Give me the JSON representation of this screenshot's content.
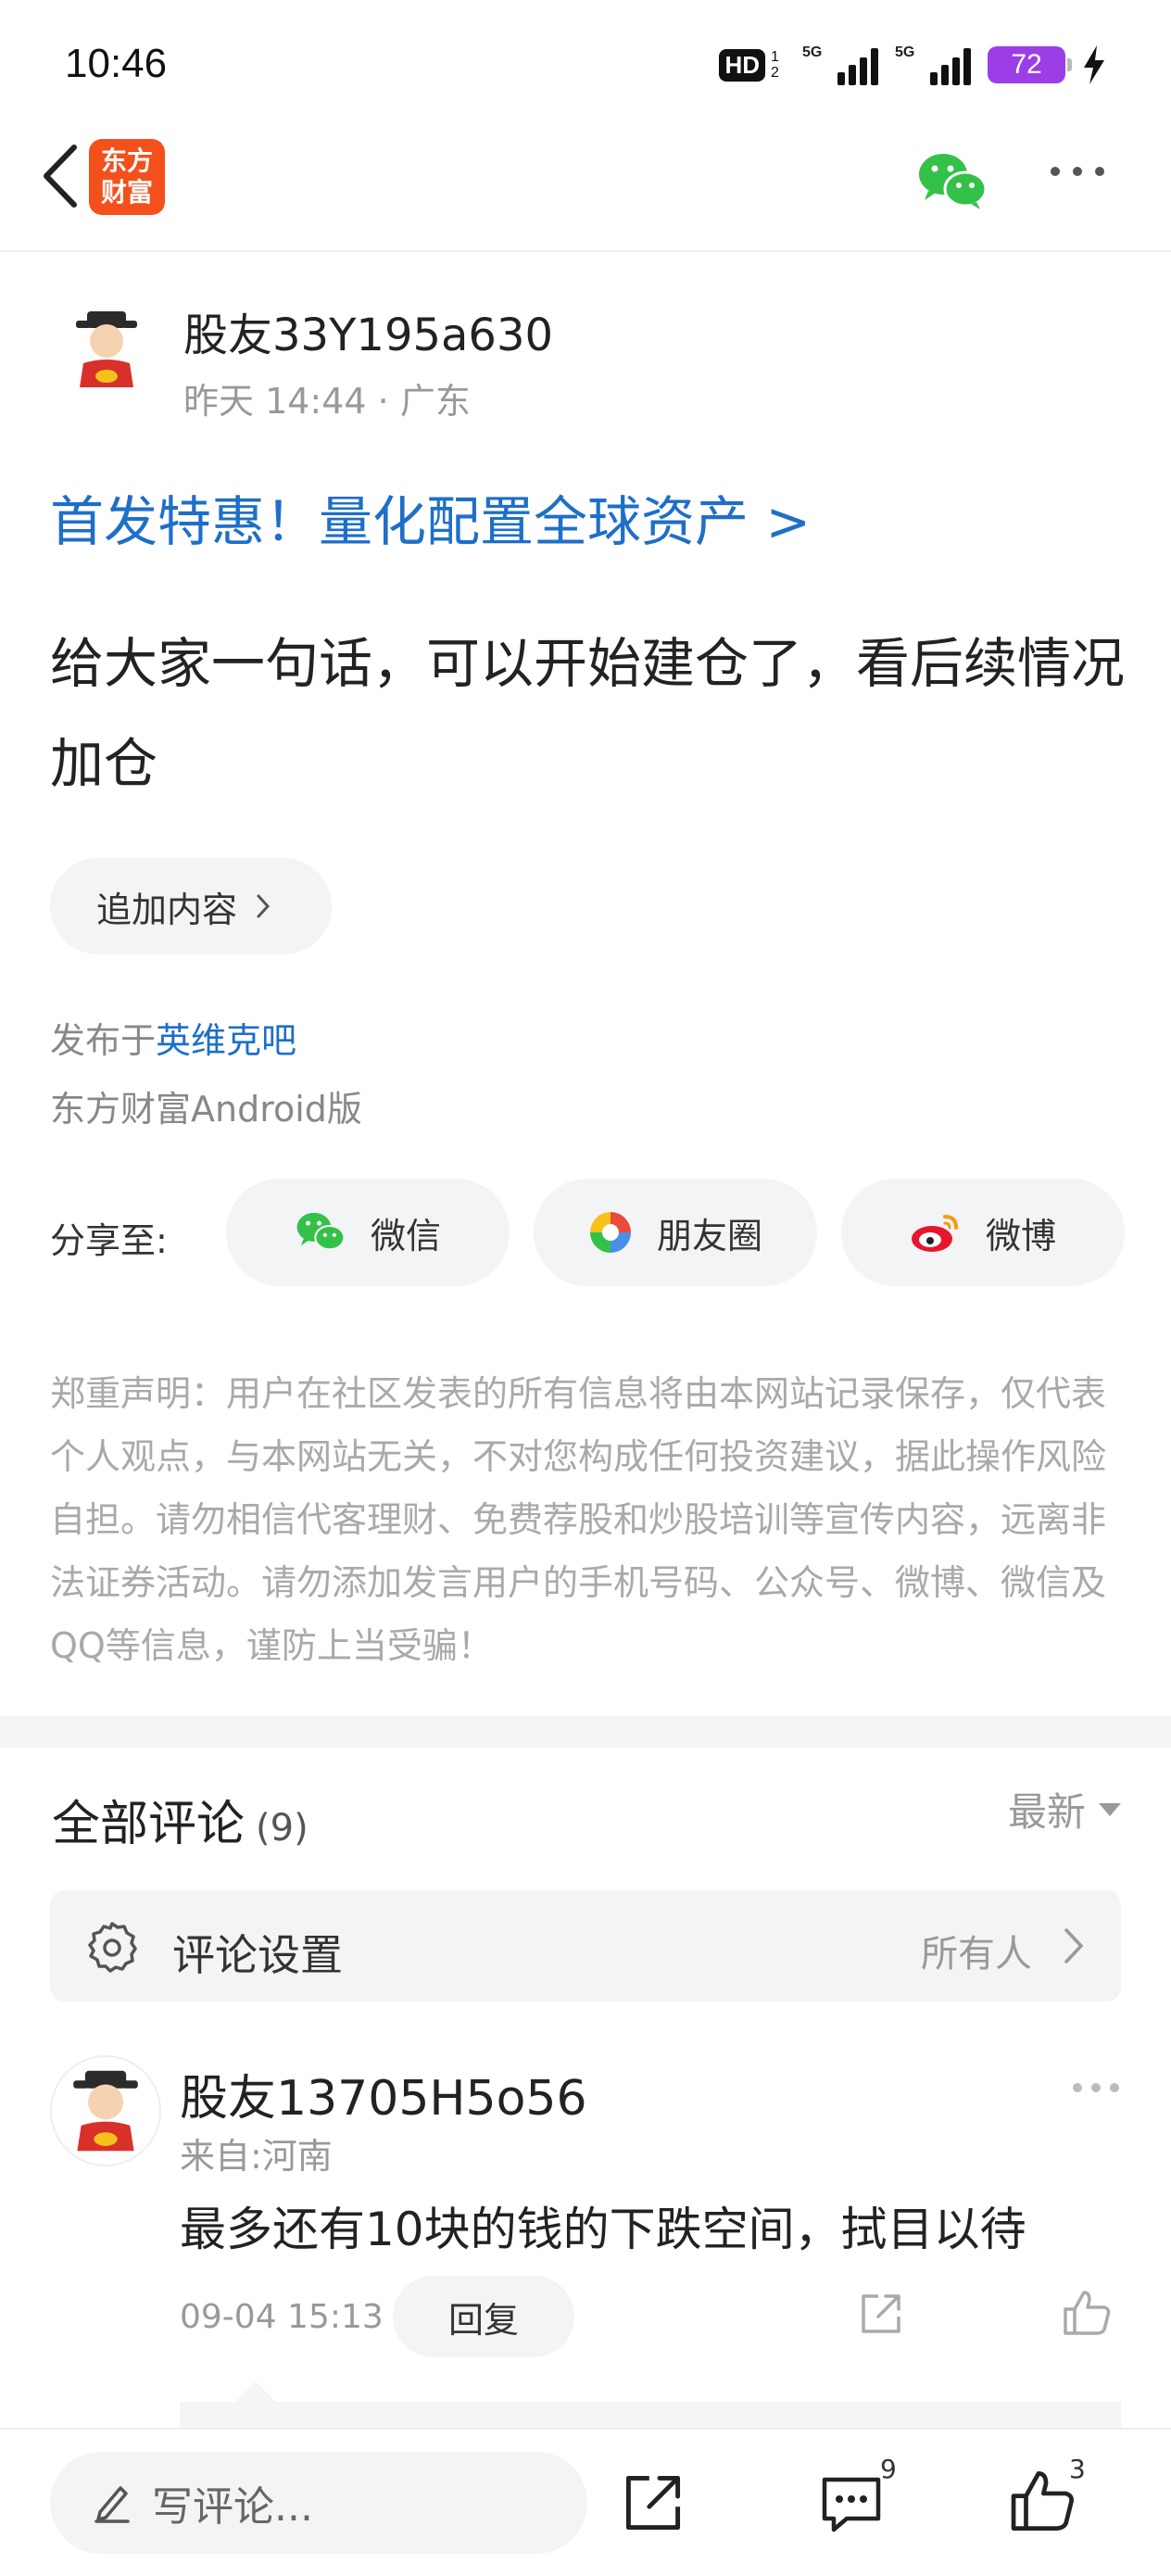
{
  "status_bar": {
    "time": "10:46",
    "hd_label": "HD",
    "hd_sub": "1 2",
    "signal1_label": "5G",
    "signal2_label": "5G",
    "battery": "72",
    "battery_color": "#9b3ee8"
  },
  "nav": {
    "logo_line1": "东方",
    "logo_line2": "财富",
    "back_icon": "chevron-left-icon",
    "wechat_icon": "wechat-icon",
    "more_icon": "more-horizontal-icon"
  },
  "post": {
    "author_name": "股友33Y195a630",
    "author_meta": "昨天 14:44 · 广东",
    "promo_text": "首发特惠！量化配置全球资产 >",
    "content": "给大家一句话，可以开始建仓了，看后续情况加仓",
    "append_label": "追加内容",
    "posted_prefix": "发布于",
    "posted_board": "英维克吧",
    "client": "东方财富Android版"
  },
  "share": {
    "label": "分享至:",
    "wechat": "微信",
    "moments": "朋友圈",
    "weibo": "微博"
  },
  "disclaimer": "郑重声明：用户在社区发表的所有信息将由本网站记录保存，仅代表个人观点，与本网站无关，不对您构成任何投资建议，据此操作风险自担。请勿相信代客理财、免费荐股和炒股培训等宣传内容，远离非法证券活动。请勿添加发言用户的手机号码、公众号、微博、微信及QQ等信息，谨防上当受骗！",
  "comments": {
    "title": "全部评论",
    "count": "(9)",
    "sort": "最新",
    "settings_label": "评论设置",
    "settings_value": "所有人",
    "items": [
      {
        "name": "股友13705H5o56",
        "location": "来自:河南",
        "text": "最多还有10块的钱的下跌空间，拭目以待",
        "time": "09-04 15:13",
        "reply_label": "回复"
      }
    ]
  },
  "bottom_bar": {
    "write_placeholder": "写评论...",
    "comment_count": "9",
    "like_count": "3"
  },
  "colors": {
    "link_blue": "#1e6fc8",
    "brand_orange": "#f4501c",
    "wechat_green": "#34c14a",
    "weibo_red": "#e6162d"
  }
}
